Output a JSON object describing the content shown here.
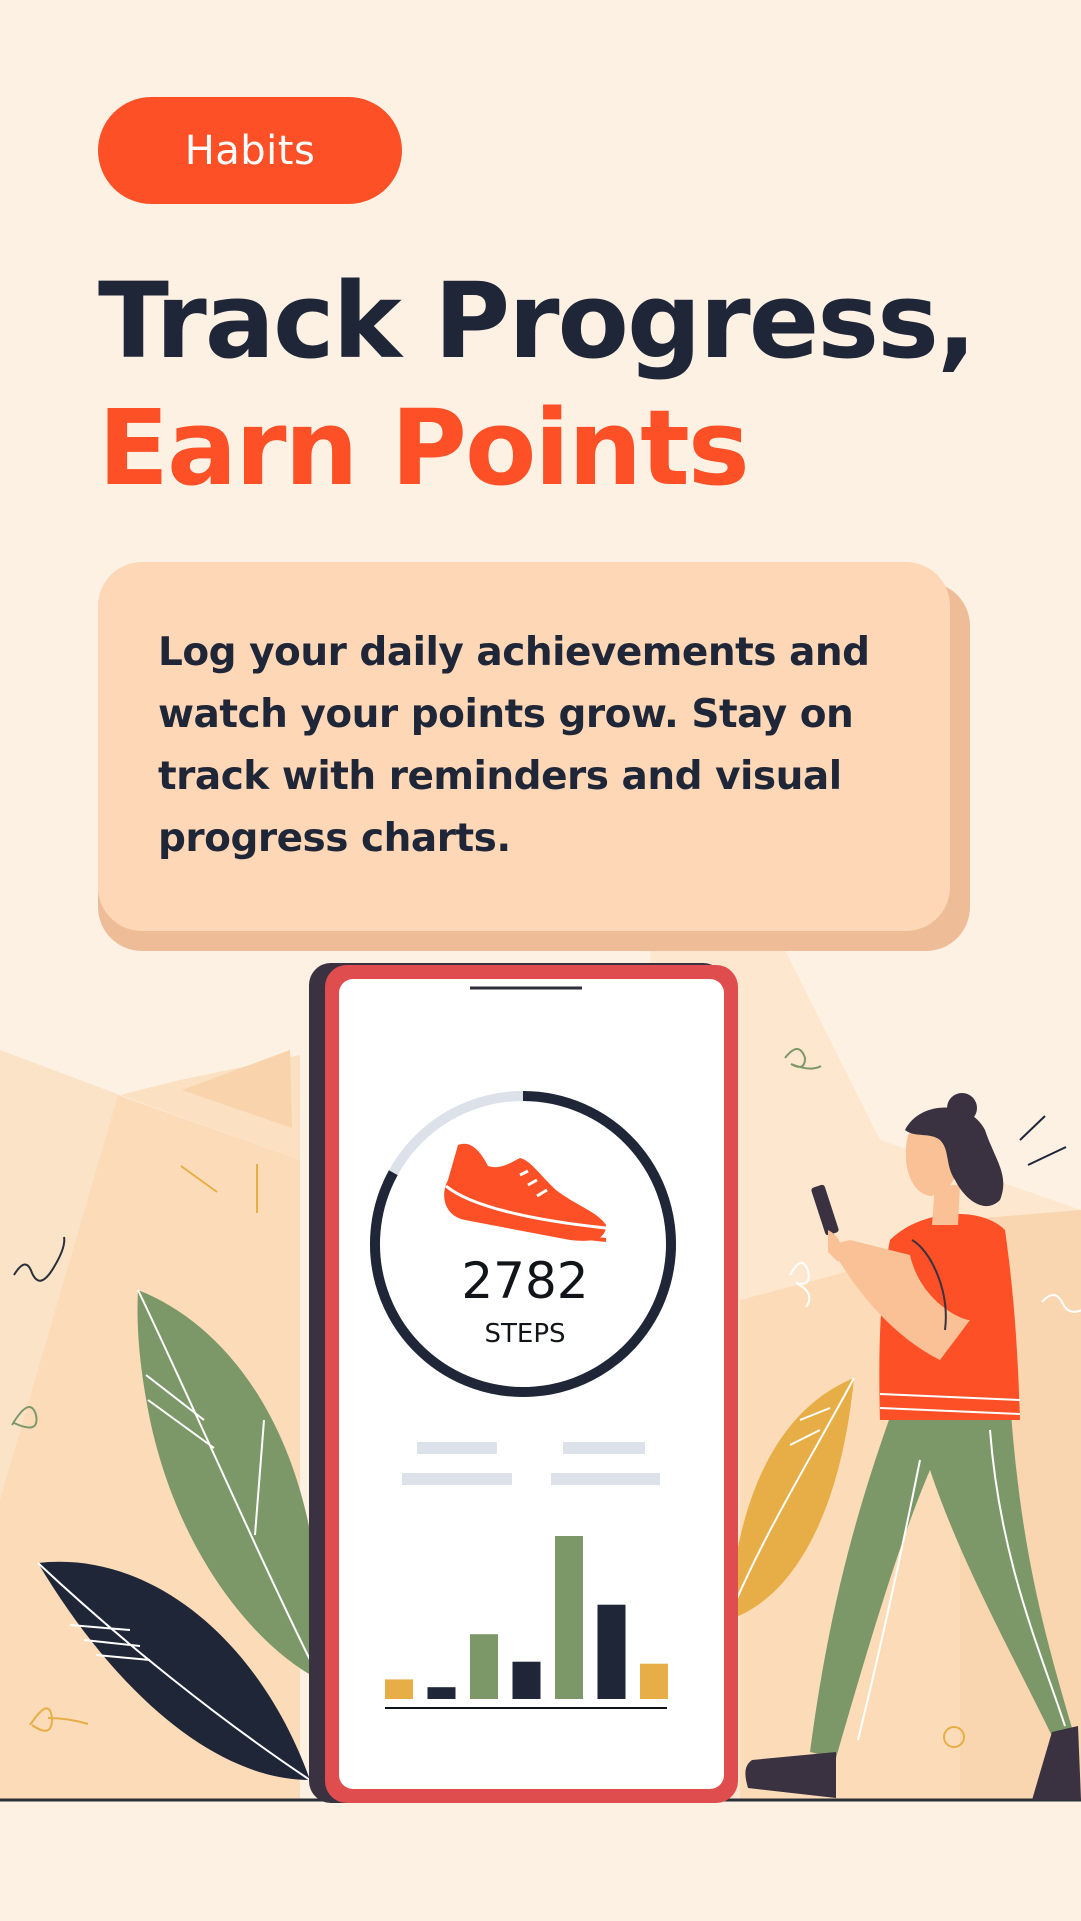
{
  "brand": {
    "logo_text": "Habits"
  },
  "headline": {
    "line1": "Track Progress,",
    "line2": "Earn Points"
  },
  "description": "Log your daily achievements and watch your points grow. Stay on track with reminders and visual progress charts.",
  "phone": {
    "steps_value": "2782",
    "steps_unit": "STEPS",
    "progress_ring_fraction": 0.83
  },
  "mini_chart": {
    "values": [
      1,
      0.6,
      3.3,
      1.9,
      8.3,
      4.8,
      1.8
    ],
    "colors": [
      "#e7ae47",
      "#1e2638",
      "#7d9868",
      "#1e2638",
      "#7d9868",
      "#1e2638",
      "#e7ae47"
    ]
  },
  "colors": {
    "accent": "#fd5027",
    "navy": "#1e2638",
    "green": "#7d9868",
    "mustard": "#e7ae47",
    "card": "#fdd7b6",
    "background": "#fdf1e4",
    "phone_frame": "#e04d4f"
  }
}
